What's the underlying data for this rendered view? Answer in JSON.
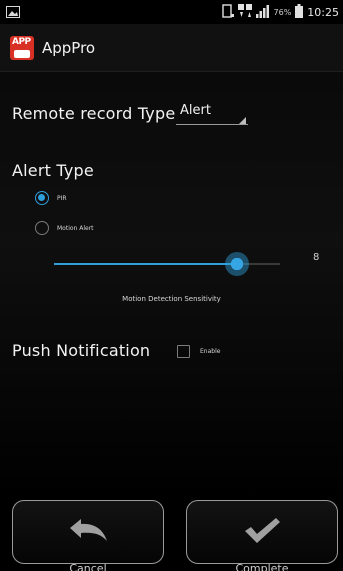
{
  "status_bar": {
    "battery_percent": "76%",
    "time": "10:25",
    "icons": [
      "image-notification-icon",
      "phone-icon",
      "data-icon",
      "signal-icon",
      "battery-icon"
    ]
  },
  "app": {
    "title": "AppPro",
    "logo_text": "APP"
  },
  "remote_record": {
    "label": "Remote record Type",
    "selected": "Alert"
  },
  "alert_type": {
    "title": "Alert Type",
    "options": [
      {
        "label": "PIR",
        "checked": true
      },
      {
        "label": "Motion Alert",
        "checked": false
      }
    ]
  },
  "sensitivity": {
    "value": "8",
    "fraction": 0.81,
    "label": "Motion Detection Sensitivity"
  },
  "push_notification": {
    "label": "Push Notification",
    "enable_label": "Enable",
    "checked": false
  },
  "footer": {
    "cancel_label": "Cancel",
    "complete_label": "Complete"
  },
  "colors": {
    "accent": "#2f9fdc",
    "logo": "#d83025",
    "background": "#000000"
  }
}
